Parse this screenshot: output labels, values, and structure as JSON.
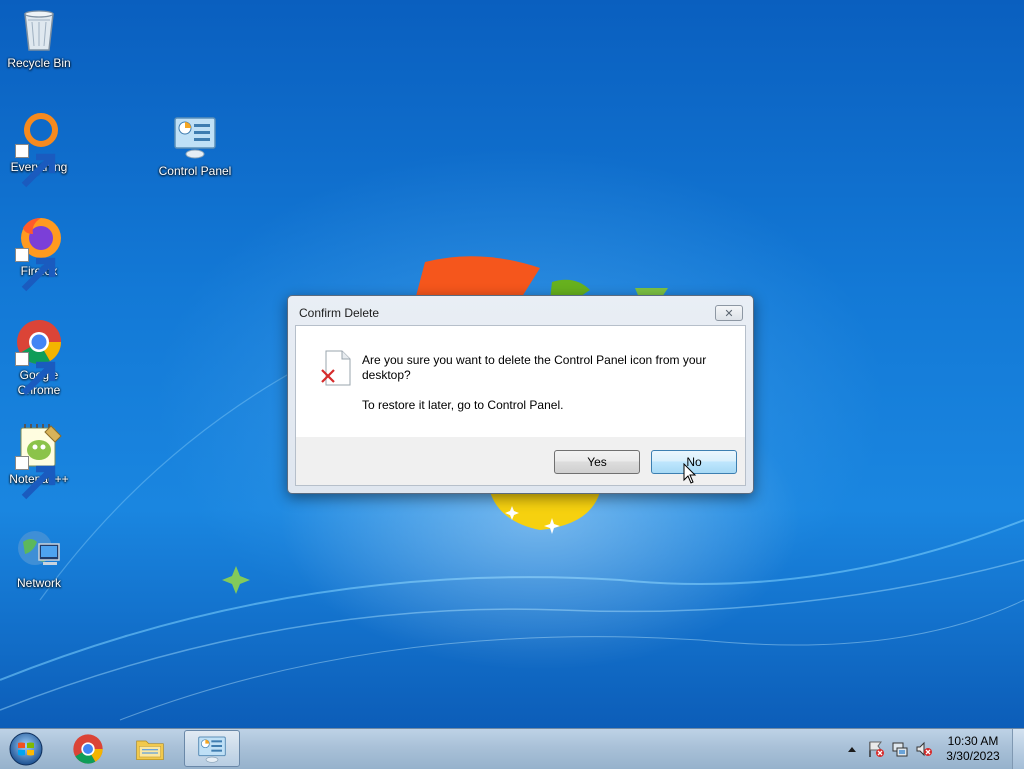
{
  "desktop": {
    "icons": [
      {
        "label": "Recycle Bin",
        "icon": "recycle-bin-icon"
      },
      {
        "label": "Everything",
        "icon": "everything-icon",
        "shortcut": true
      },
      {
        "label": "Control Panel",
        "icon": "control-panel-icon"
      },
      {
        "label": "Firefox",
        "icon": "firefox-icon",
        "shortcut": true
      },
      {
        "label": "Google Chrome",
        "icon": "chrome-icon",
        "shortcut": true
      },
      {
        "label": "Notepad++",
        "icon": "notepadpp-icon",
        "shortcut": true
      },
      {
        "label": "Network",
        "icon": "network-icon"
      }
    ]
  },
  "dialog": {
    "title": "Confirm Delete",
    "message": "Are you sure you want to delete the Control Panel icon from your desktop?",
    "submessage": "To restore it later, go to Control Panel.",
    "yes_label": "Yes",
    "no_label": "No",
    "close_glyph": "✕"
  },
  "taskbar": {
    "pinned": [
      {
        "name": "chrome",
        "icon": "chrome-icon"
      },
      {
        "name": "file-explorer",
        "icon": "folder-icon"
      },
      {
        "name": "control-panel",
        "icon": "control-panel-icon",
        "active": true
      }
    ],
    "tray_icons": [
      "show-hidden-icons-icon",
      "action-center-flag-icon",
      "network-status-icon",
      "volume-muted-icon"
    ],
    "clock": {
      "time": "10:30 AM",
      "date": "3/30/2023"
    }
  },
  "colors": {
    "desktop_blue": "#1379d6",
    "dialog_button_focus": "#bee6fd",
    "taskbar": "#a9c1d8"
  }
}
